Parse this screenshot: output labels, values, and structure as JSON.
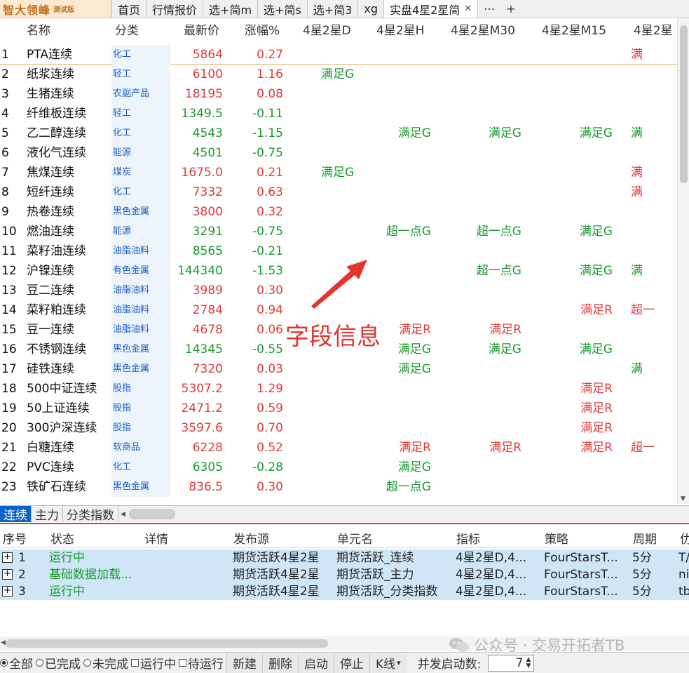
{
  "logo": {
    "main": "智大领峰",
    "sub": "测试版"
  },
  "tabs": [
    {
      "label": "首页"
    },
    {
      "label": "行情报价"
    },
    {
      "label": "选+简m"
    },
    {
      "label": "选+简s"
    },
    {
      "label": "选+简3"
    },
    {
      "label": "xg"
    },
    {
      "label": "实盘4星2星简",
      "active": true
    }
  ],
  "tab_more": "⋯",
  "tab_add": "+",
  "grid": {
    "headers": {
      "name": "名称",
      "category": "分类",
      "price": "最新价",
      "change": "涨幅%",
      "d": "4星2星D",
      "h": "4星2星H",
      "m30": "4星2星M30",
      "m15": "4星2星M15",
      "x": "4星2星"
    },
    "rows": [
      {
        "idx": "1",
        "name": "PTA连续",
        "cat": "化工",
        "price": "5864",
        "chg": "0.27",
        "dir": "up",
        "d": "",
        "h": "",
        "m30": "",
        "m15": "",
        "x": "满",
        "xc": "red"
      },
      {
        "idx": "2",
        "name": "纸浆连续",
        "cat": "轻工",
        "price": "6100",
        "chg": "1.16",
        "dir": "up",
        "d": "满足G",
        "h": "",
        "m30": "",
        "m15": "",
        "x": "",
        "xc": ""
      },
      {
        "idx": "3",
        "name": "生猪连续",
        "cat": "农副产品",
        "price": "18195",
        "chg": "0.08",
        "dir": "up",
        "d": "",
        "h": "",
        "m30": "",
        "m15": "",
        "x": "",
        "xc": ""
      },
      {
        "idx": "4",
        "name": "纤维板连续",
        "cat": "轻工",
        "price": "1349.5",
        "chg": "-0.11",
        "dir": "down",
        "d": "",
        "h": "",
        "m30": "",
        "m15": "",
        "x": "",
        "xc": ""
      },
      {
        "idx": "5",
        "name": "乙二醇连续",
        "cat": "化工",
        "price": "4543",
        "chg": "-1.15",
        "dir": "down",
        "d": "",
        "h": "满足G",
        "hc": "green",
        "m30": "满足G",
        "m30c": "green",
        "m15": "满足G",
        "m15c": "green",
        "x": "满",
        "xc": "green"
      },
      {
        "idx": "6",
        "name": "液化气连续",
        "cat": "能源",
        "price": "4501",
        "chg": "-0.75",
        "dir": "down",
        "d": "",
        "h": "",
        "m30": "",
        "m15": "",
        "x": "",
        "xc": ""
      },
      {
        "idx": "7",
        "name": "焦煤连续",
        "cat": "煤炭",
        "price": "1675.0",
        "chg": "0.21",
        "dir": "up",
        "d": "满足G",
        "h": "",
        "m30": "",
        "m15": "",
        "x": "满",
        "xc": "red"
      },
      {
        "idx": "8",
        "name": "短纤连续",
        "cat": "化工",
        "price": "7332",
        "chg": "0.63",
        "dir": "up",
        "d": "",
        "h": "",
        "m30": "",
        "m15": "",
        "x": "满",
        "xc": "red"
      },
      {
        "idx": "9",
        "name": "热卷连续",
        "cat": "黑色金属",
        "price": "3800",
        "chg": "0.32",
        "dir": "up",
        "d": "",
        "h": "",
        "m30": "",
        "m15": "",
        "x": "",
        "xc": ""
      },
      {
        "idx": "10",
        "name": "燃油连续",
        "cat": "能源",
        "price": "3291",
        "chg": "-0.75",
        "dir": "down",
        "d": "",
        "h": "超一点G",
        "hc": "green",
        "m30": "超一点G",
        "m30c": "green",
        "m15": "满足G",
        "m15c": "green",
        "x": "",
        "xc": ""
      },
      {
        "idx": "11",
        "name": "菜籽油连续",
        "cat": "油脂油料",
        "price": "8565",
        "chg": "-0.21",
        "dir": "down",
        "d": "",
        "h": "",
        "m30": "",
        "m15": "",
        "x": "",
        "xc": ""
      },
      {
        "idx": "12",
        "name": "沪镍连续",
        "cat": "有色金属",
        "price": "144340",
        "chg": "-1.53",
        "dir": "down",
        "d": "",
        "h": "",
        "m30": "超一点G",
        "m30c": "green",
        "m15": "满足G",
        "m15c": "green",
        "x": "满",
        "xc": "green"
      },
      {
        "idx": "13",
        "name": "豆二连续",
        "cat": "油脂油料",
        "price": "3989",
        "chg": "0.30",
        "dir": "up",
        "d": "",
        "h": "",
        "m30": "",
        "m15": "",
        "x": "",
        "xc": ""
      },
      {
        "idx": "14",
        "name": "菜籽粕连续",
        "cat": "油脂油料",
        "price": "2784",
        "chg": "0.94",
        "dir": "up",
        "d": "",
        "h": "",
        "m30": "",
        "m15": "满足R",
        "m15c": "red",
        "x": "超一",
        "xc": "red"
      },
      {
        "idx": "15",
        "name": "豆一连续",
        "cat": "油脂油料",
        "price": "4678",
        "chg": "0.06",
        "dir": "up",
        "d": "",
        "h": "满足R",
        "hc": "red",
        "m30": "满足R",
        "m30c": "red",
        "m15": "",
        "x": "",
        "xc": ""
      },
      {
        "idx": "16",
        "name": "不锈钢连续",
        "cat": "黑色金属",
        "price": "14345",
        "chg": "-0.55",
        "dir": "down",
        "d": "",
        "h": "满足G",
        "hc": "green",
        "m30": "满足G",
        "m30c": "green",
        "m15": "满足G",
        "m15c": "green",
        "x": "",
        "xc": ""
      },
      {
        "idx": "17",
        "name": "硅铁连续",
        "cat": "黑色金属",
        "price": "7320",
        "chg": "0.03",
        "dir": "up",
        "d": "",
        "h": "满足G",
        "hc": "green",
        "m30": "",
        "m15": "",
        "x": "满",
        "xc": "green"
      },
      {
        "idx": "18",
        "name": "500中证连续",
        "cat": "股指",
        "price": "5307.2",
        "chg": "1.29",
        "dir": "up",
        "d": "",
        "h": "",
        "m30": "",
        "m15": "满足R",
        "m15c": "red",
        "x": "",
        "xc": ""
      },
      {
        "idx": "19",
        "name": "50上证连续",
        "cat": "股指",
        "price": "2471.2",
        "chg": "0.59",
        "dir": "up",
        "d": "",
        "h": "",
        "m30": "",
        "m15": "满足R",
        "m15c": "red",
        "x": "",
        "xc": ""
      },
      {
        "idx": "20",
        "name": "300沪深连续",
        "cat": "股指",
        "price": "3597.6",
        "chg": "0.70",
        "dir": "up",
        "d": "",
        "h": "",
        "m30": "",
        "m15": "满足R",
        "m15c": "red",
        "x": "",
        "xc": ""
      },
      {
        "idx": "21",
        "name": "白糖连续",
        "cat": "软商品",
        "price": "6228",
        "chg": "0.52",
        "dir": "up",
        "d": "",
        "h": "满足R",
        "hc": "red",
        "m30": "满足R",
        "m30c": "red",
        "m15": "满足R",
        "m15c": "red",
        "x": "超一",
        "xc": "red"
      },
      {
        "idx": "22",
        "name": "PVC连续",
        "cat": "化工",
        "price": "6305",
        "chg": "-0.28",
        "dir": "down",
        "d": "",
        "h": "满足G",
        "hc": "green",
        "m30": "",
        "m15": "",
        "x": "",
        "xc": ""
      },
      {
        "idx": "23",
        "name": "铁矿石连续",
        "cat": "黑色金属",
        "price": "836.5",
        "chg": "0.30",
        "dir": "up",
        "d": "",
        "h": "超一点G",
        "hc": "green",
        "m30": "",
        "m15": "",
        "x": "",
        "xc": ""
      }
    ]
  },
  "annotation": {
    "text": "字段信息",
    "color": "#e3342f"
  },
  "sheets": [
    {
      "label": "连续",
      "active": true
    },
    {
      "label": "主力"
    },
    {
      "label": "分类指数"
    }
  ],
  "tasks": {
    "headers": {
      "seq": "序号",
      "status": "状态",
      "detail": "详情",
      "publisher": "发布源",
      "unit": "单元名",
      "indicator": "指标",
      "strategy": "策略",
      "period": "周期",
      "extra": "仂"
    },
    "rows": [
      {
        "seq": "1",
        "status": "运行中",
        "publisher": "期货活跃4星2星",
        "unit": "期货活跃_连续",
        "indicator": "4星2星D,4...",
        "strategy": "FourStarsT...",
        "period": "5分",
        "extra": "T/"
      },
      {
        "seq": "2",
        "status": "基础数据加载...",
        "publisher": "期货活跃4星2星",
        "unit": "期货活跃_主力",
        "indicator": "4星2星D,4...",
        "strategy": "FourStarsT...",
        "period": "5分",
        "extra": "ni"
      },
      {
        "seq": "3",
        "status": "运行中",
        "publisher": "期货活跃4星2星",
        "unit": "期货活跃_分类指数",
        "indicator": "4星2星D,4...",
        "strategy": "FourStarsT...",
        "period": "5分",
        "extra": "tb"
      }
    ]
  },
  "toolbar": {
    "filters": [
      {
        "label": "全部",
        "kind": "radio",
        "checked": true
      },
      {
        "label": "已完成",
        "kind": "radio",
        "checked": false
      },
      {
        "label": "未完成",
        "kind": "radio",
        "checked": false
      },
      {
        "label": "运行中",
        "kind": "check",
        "checked": false
      },
      {
        "label": "待运行",
        "kind": "check",
        "checked": false
      }
    ],
    "buttons": {
      "new": "新建",
      "delete": "删除",
      "start": "启动",
      "stop": "停止",
      "kline": "K线"
    },
    "concurrency_label": "并发启动数:",
    "concurrency_value": "7"
  },
  "watermark": {
    "text": "公众号 · 交易开拓者TB"
  },
  "colors": {
    "up": "#e23b3b",
    "down": "#1a9a2e",
    "accent": "#0b63c8",
    "category": "#1a5fc0"
  }
}
